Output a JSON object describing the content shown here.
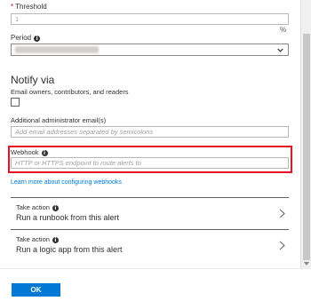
{
  "threshold": {
    "required_mark": "*",
    "label": "Threshold",
    "value": "1",
    "unit": "%"
  },
  "period": {
    "label": "Period",
    "info_icon": "i"
  },
  "notify": {
    "title": "Notify via",
    "email_owners_label": "Email owners, contributors, and readers",
    "email_owners_checked": false,
    "admin_email_label": "Additional administrator email(s)",
    "admin_email_placeholder": "Add email addresses separated by semicolons",
    "webhook_label": "Webhook",
    "webhook_placeholder": "HTTP or HTTPS endpoint to route alerts to",
    "webhook_info_icon": "i",
    "learn_more_link": "Learn more about configuring webhooks"
  },
  "actions": [
    {
      "label": "Take action",
      "info_icon": "i",
      "text": "Run a runbook from this alert"
    },
    {
      "label": "Take action",
      "info_icon": "i",
      "text": "Run a logic app from this alert"
    }
  ],
  "footer": {
    "ok_label": "OK"
  },
  "colors": {
    "accent": "#0078d4",
    "highlight": "#e81123",
    "link": "#0078d4"
  }
}
